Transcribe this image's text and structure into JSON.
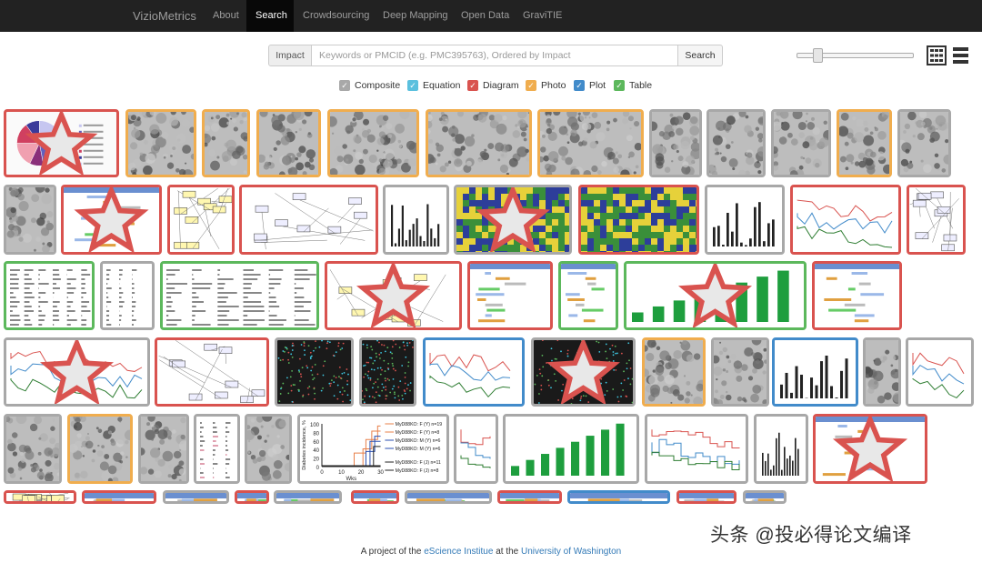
{
  "nav": {
    "brand": "VizioMetrics",
    "items": [
      {
        "label": "About"
      },
      {
        "label": "Search",
        "active": true
      },
      {
        "label": "Crowdsourcing"
      },
      {
        "label": "Deep Mapping"
      },
      {
        "label": "Open Data"
      },
      {
        "label": "GraviTIE"
      }
    ]
  },
  "search": {
    "addon_label": "Impact",
    "placeholder": "Keywords or PMCID (e.g. PMC395763), Ordered by Impact",
    "value": "",
    "button_label": "Search"
  },
  "slider_level": 0.15,
  "view_icons": {
    "grid": "grid-view-icon",
    "list": "list-view-icon"
  },
  "filters": [
    {
      "label": "Composite",
      "color": "#a8a8a8",
      "checked": true
    },
    {
      "label": "Equation",
      "color": "#5bc0de",
      "checked": true
    },
    {
      "label": "Diagram",
      "color": "#d9534f",
      "checked": true
    },
    {
      "label": "Photo",
      "color": "#f0ad4e",
      "checked": true
    },
    {
      "label": "Plot",
      "color": "#428bca",
      "checked": true
    },
    {
      "label": "Table",
      "color": "#5cb85c",
      "checked": true
    }
  ],
  "category_colors": {
    "composite": "#a8a8a8",
    "equation": "#5bc0de",
    "diagram": "#d9534f",
    "photo": "#f0ad4e",
    "plot": "#428bca",
    "table": "#5cb85c"
  },
  "thumbnails": [
    {
      "cat": "diagram",
      "style": "pie",
      "starred": true
    },
    {
      "cat": "photo",
      "style": "micro"
    },
    {
      "cat": "photo",
      "style": "micro"
    },
    {
      "cat": "photo",
      "style": "micro"
    },
    {
      "cat": "photo",
      "style": "micro"
    },
    {
      "cat": "photo",
      "style": "micro"
    },
    {
      "cat": "photo",
      "style": "micro"
    },
    {
      "cat": "composite",
      "style": "micro"
    },
    {
      "cat": "composite",
      "style": "micro"
    },
    {
      "cat": "composite",
      "style": "micro"
    },
    {
      "cat": "photo",
      "style": "micro"
    },
    {
      "cat": "composite",
      "style": "micro"
    },
    {
      "cat": "composite",
      "style": "micro"
    },
    {
      "cat": "diagram",
      "style": "ui",
      "starred": true
    },
    {
      "cat": "diagram",
      "style": "flow"
    },
    {
      "cat": "diagram",
      "style": "tree"
    },
    {
      "cat": "composite",
      "style": "bars"
    },
    {
      "cat": "composite",
      "style": "heat",
      "starred": true
    },
    {
      "cat": "diagram",
      "style": "heat"
    },
    {
      "cat": "composite",
      "style": "bars"
    },
    {
      "cat": "diagram",
      "style": "lines"
    },
    {
      "cat": "diagram",
      "style": "network"
    },
    {
      "cat": "table",
      "style": "table"
    },
    {
      "cat": "composite",
      "style": "table"
    },
    {
      "cat": "table",
      "style": "table"
    },
    {
      "cat": "diagram",
      "style": "flow",
      "starred": true
    },
    {
      "cat": "diagram",
      "style": "ui"
    },
    {
      "cat": "table",
      "style": "ui"
    },
    {
      "cat": "table",
      "style": "barchart",
      "starred": true
    },
    {
      "cat": "diagram",
      "style": "ui"
    },
    {
      "cat": "composite",
      "style": "lines",
      "starred": true
    },
    {
      "cat": "diagram",
      "style": "tree"
    },
    {
      "cat": "composite",
      "style": "scatter"
    },
    {
      "cat": "composite",
      "style": "scatter"
    },
    {
      "cat": "plot",
      "style": "lines"
    },
    {
      "cat": "composite",
      "style": "scatter",
      "starred": true
    },
    {
      "cat": "photo",
      "style": "micro"
    },
    {
      "cat": "composite",
      "style": "micro"
    },
    {
      "cat": "plot",
      "style": "bars"
    },
    {
      "cat": "composite",
      "style": "micro"
    },
    {
      "cat": "composite",
      "style": "lines"
    },
    {
      "cat": "composite",
      "style": "micro"
    },
    {
      "cat": "photo",
      "style": "micro"
    },
    {
      "cat": "composite",
      "style": "micro"
    },
    {
      "cat": "composite",
      "style": "text"
    },
    {
      "cat": "composite",
      "style": "micro"
    },
    {
      "cat": "composite",
      "style": "step"
    },
    {
      "cat": "composite",
      "style": "barchart"
    },
    {
      "cat": "composite",
      "style": "step"
    },
    {
      "cat": "composite",
      "style": "bars"
    },
    {
      "cat": "diagram",
      "style": "ui",
      "starred": true
    },
    {
      "cat": "diagram",
      "style": "flow"
    },
    {
      "cat": "diagram",
      "style": "ui"
    },
    {
      "cat": "composite",
      "style": "ui"
    },
    {
      "cat": "diagram",
      "style": "ui"
    },
    {
      "cat": "composite",
      "style": "ui"
    },
    {
      "cat": "diagram",
      "style": "ui"
    },
    {
      "cat": "composite",
      "style": "ui"
    },
    {
      "cat": "diagram",
      "style": "ui"
    },
    {
      "cat": "plot",
      "style": "ui"
    },
    {
      "cat": "diagram",
      "style": "ui"
    },
    {
      "cat": "composite",
      "style": "ui"
    },
    {
      "cat": "plot",
      "style": "ui"
    }
  ],
  "featured_plot": {
    "legend": [
      "MyD88KO: F (Y) n=19",
      "MyD88KO: F (Y) n=8",
      "MyD88KO: M (Y) n=6",
      "MyD88KO: M (Y) n=6",
      "MyD88KO: F (J) n=11",
      "MyD88KO: F (J) n=8"
    ],
    "ylabel": "Diabetes incidence, %",
    "xlabel": "Wks",
    "yticks": [
      "100",
      "80",
      "60",
      "40",
      "20",
      "0"
    ],
    "xticks": [
      "0",
      "10",
      "20",
      "30"
    ]
  },
  "footer": {
    "prefix": "A project of the ",
    "link1": "eScience Institue",
    "middle": " at the ",
    "link2": "University of Washington"
  },
  "watermark": "头条 @投必得论文编译"
}
